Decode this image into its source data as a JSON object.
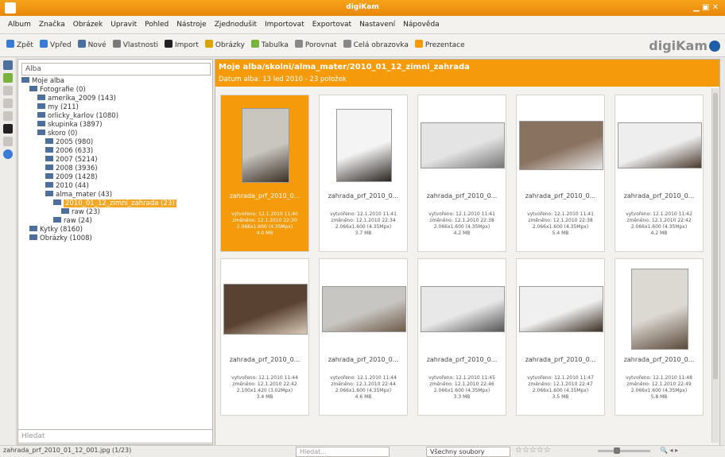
{
  "window": {
    "title": "digiKam"
  },
  "menu": [
    "Album",
    "Značka",
    "Obrázek",
    "Upravit",
    "Pohled",
    "Nástroje",
    "Zjednodušit",
    "Importovat",
    "Exportovat",
    "Nastavení",
    "Nápověda"
  ],
  "toolbar": [
    {
      "label": "Zpět",
      "icon": "back-arrow-icon",
      "color": "#3a7bd5"
    },
    {
      "label": "Vpřed",
      "icon": "forward-arrow-icon",
      "color": "#3a7bd5"
    },
    {
      "label": "Nové",
      "icon": "new-album-icon",
      "color": "#4d6f9e"
    },
    {
      "label": "Vlastnosti",
      "icon": "properties-icon",
      "color": "#7a7a7a"
    },
    {
      "label": "Import",
      "icon": "import-icon",
      "color": "#222"
    },
    {
      "label": "Obrázky",
      "icon": "image-editor-icon",
      "color": "#d9a400"
    },
    {
      "label": "Tabulka",
      "icon": "table-icon",
      "color": "#7ab23f"
    },
    {
      "label": "Porovnat",
      "icon": "compare-icon",
      "color": "#888"
    },
    {
      "label": "Celá obrazovka",
      "icon": "fullscreen-icon",
      "color": "#888"
    },
    {
      "label": "Prezentace",
      "icon": "slideshow-icon",
      "color": "#f59a0a"
    }
  ],
  "logo": "digiKam",
  "tree": {
    "search_value": "Alba",
    "filter_placeholder": "Hledat",
    "rows": [
      {
        "label": "Moje alba",
        "indent": 0,
        "selected": false
      },
      {
        "label": "Fotografie (0)",
        "indent": 1,
        "selected": false
      },
      {
        "label": "amerika_2009 (143)",
        "indent": 2,
        "selected": false
      },
      {
        "label": "my (211)",
        "indent": 2,
        "selected": false
      },
      {
        "label": "orlicky_karlov (1080)",
        "indent": 2,
        "selected": false
      },
      {
        "label": "skupinka (3897)",
        "indent": 2,
        "selected": false
      },
      {
        "label": "skoro (0)",
        "indent": 2,
        "selected": false
      },
      {
        "label": "2005 (980)",
        "indent": 3,
        "selected": false
      },
      {
        "label": "2006 (633)",
        "indent": 3,
        "selected": false
      },
      {
        "label": "2007 (5214)",
        "indent": 3,
        "selected": false
      },
      {
        "label": "2008 (3936)",
        "indent": 3,
        "selected": false
      },
      {
        "label": "2009 (1428)",
        "indent": 3,
        "selected": false
      },
      {
        "label": "2010 (44)",
        "indent": 3,
        "selected": false
      },
      {
        "label": "alma_mater (43)",
        "indent": 3,
        "selected": false
      },
      {
        "label": "2010_01_12_zimni_zahrada (23)",
        "indent": 4,
        "selected": true
      },
      {
        "label": "raw (23)",
        "indent": 5,
        "selected": false
      },
      {
        "label": "raw (24)",
        "indent": 4,
        "selected": false
      },
      {
        "label": "Kytky (8160)",
        "indent": 1,
        "selected": false
      },
      {
        "label": "Obrázky (1008)",
        "indent": 1,
        "selected": false
      }
    ]
  },
  "header": {
    "title": "Moje alba/skolni/alma_mater/2010_01_12_zimni_zahrada",
    "subtitle": "Datum alba: 13 led 2010 - 23 položek"
  },
  "tiles": [
    {
      "name": "zahrada_prf_2010_0...",
      "meta": [
        "vytvořeno: 12.1.2010 11:40",
        "změněno: 12.1.2010 22:30",
        "2.066x1.600 (4.35Mpx)",
        "4.0 MB"
      ],
      "selected": true
    },
    {
      "name": "zahrada_prf_2010_0...",
      "meta": [
        "vytvořeno: 12.1.2010 11:41",
        "změněno: 12.1.2010 22:34",
        "2.066x1.600 (4.35Mpx)",
        "3.7 MB"
      ],
      "selected": false
    },
    {
      "name": "zahrada_prf_2010_0...",
      "meta": [
        "vytvořeno: 12.1.2010 11:41",
        "změněno: 12.1.2010 22:38",
        "2.066x1.600 (4.35Mpx)",
        "4.2 MB"
      ],
      "selected": false
    },
    {
      "name": "zahrada_prf_2010_0...",
      "meta": [
        "vytvořeno: 12.1.2010 11:41",
        "změněno: 12.1.2010 22:38",
        "2.066x1.600 (4.35Mpx)",
        "5.4 MB"
      ],
      "selected": false
    },
    {
      "name": "zahrada_prf_2010_0...",
      "meta": [
        "vytvořeno: 12.1.2010 11:42",
        "změněno: 12.1.2010 22:42",
        "2.066x1.600 (4.35Mpx)",
        "4.2 MB"
      ],
      "selected": false
    },
    {
      "name": "zahrada_prf_2010_0...",
      "meta": [
        "vytvořeno: 12.1.2010 11:44",
        "změněno: 12.1.2010 22:42",
        "2.100x1.420 (3.02Mpx)",
        "3.4 MB"
      ],
      "selected": false
    },
    {
      "name": "zahrada_prf_2010_0...",
      "meta": [
        "vytvořeno: 12.1.2010 11:44",
        "změněno: 12.1.2010 22:44",
        "2.066x1.600 (4.35Mpx)",
        "4.6 MB"
      ],
      "selected": false
    },
    {
      "name": "zahrada_prf_2010_0...",
      "meta": [
        "vytvořeno: 12.1.2010 11:45",
        "změněno: 12.1.2010 22:46",
        "2.066x1.600 (4.35Mpx)",
        "3.3 MB"
      ],
      "selected": false
    },
    {
      "name": "zahrada_prf_2010_0...",
      "meta": [
        "vytvořeno: 12.1.2010 11:47",
        "změněno: 12.1.2010 22:47",
        "2.066x1.600 (4.35Mpx)",
        "3.5 MB"
      ],
      "selected": false
    },
    {
      "name": "zahrada_prf_2010_0...",
      "meta": [
        "vytvořeno: 12.1.2010 11:48",
        "změněno: 12.1.2010 22:49",
        "2.066x1.600 (4.35Mpx)",
        "5.8 MB"
      ],
      "selected": false
    }
  ],
  "status": {
    "file": "zahrada_prf_2010_01_12_001.jpg (1/23)",
    "search_placeholder": "Hledat...",
    "filter_value": "Všechny soubory",
    "rating": "☆☆☆☆☆"
  }
}
